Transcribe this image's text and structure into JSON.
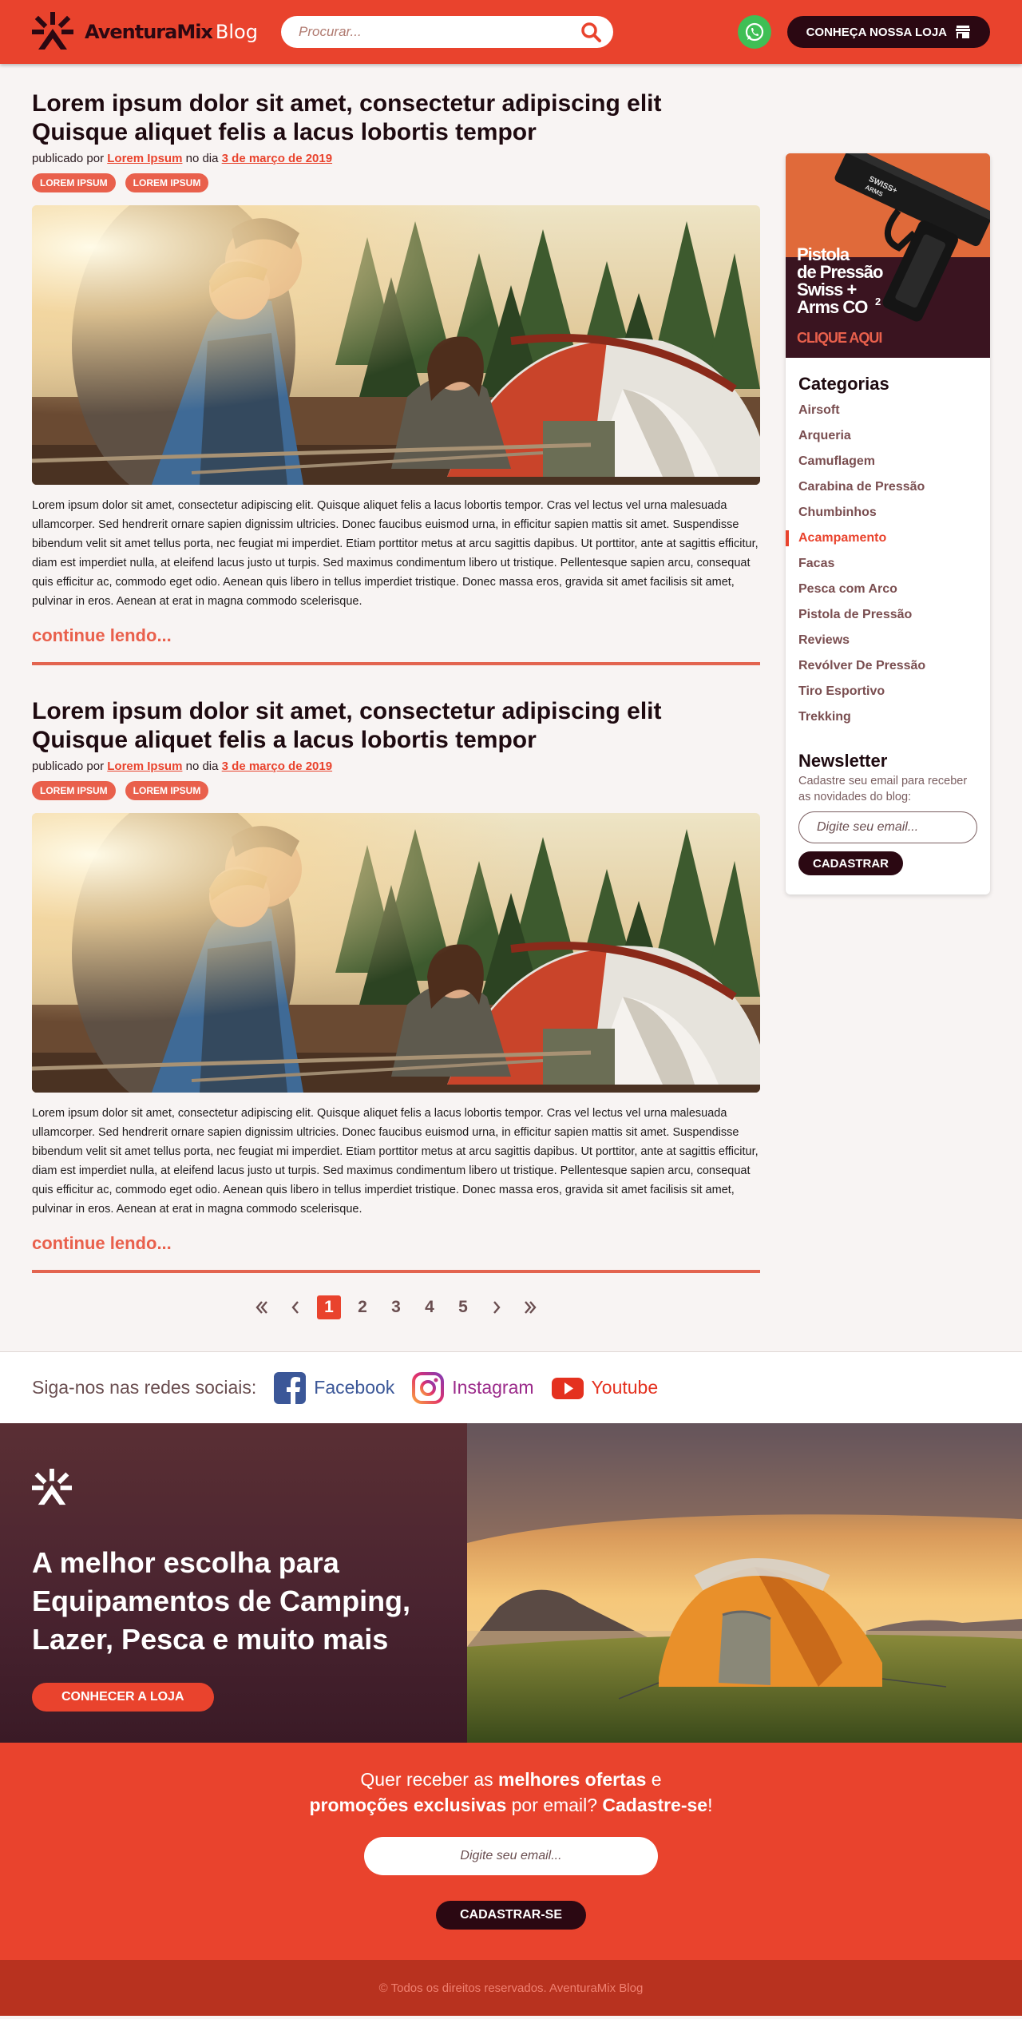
{
  "header": {
    "logo_text": "AventuraMix",
    "logo_suffix": "Blog",
    "search_placeholder": "Procurar...",
    "store_button": "CONHEÇA NOSSA LOJA",
    "icons": {
      "search": "search-icon",
      "whatsapp": "whatsapp-icon",
      "store": "store-icon"
    }
  },
  "posts": [
    {
      "title_line1": "Lorem ipsum dolor sit amet, consectetur adipiscing elit",
      "title_line2": "Quisque aliquet felis a lacus lobortis tempor",
      "meta_prefix": "publicado por",
      "author": "Lorem Ipsum",
      "meta_mid": "no dia",
      "date": "3 de março de 2019",
      "tags": [
        "LOREM IPSUM",
        "LOREM IPSUM"
      ],
      "body": "Lorem ipsum dolor sit amet, consectetur adipiscing elit. Quisque aliquet felis a lacus lobortis tempor. Cras vel lectus vel urna malesuada ullamcorper. Sed hendrerit ornare sapien dignissim ultricies. Donec faucibus euismod urna, in efficitur sapien mattis sit amet. Suspendisse bibendum velit sit amet tellus porta, nec feugiat mi imperdiet. Etiam porttitor metus at arcu sagittis dapibus. Ut porttitor, ante at sagittis efficitur, diam est imperdiet nulla, at eleifend lacus justo ut turpis. Sed maximus condimentum libero ut tristique. Pellentesque sapien arcu, consequat quis efficitur ac, commodo eget odio. Aenean quis libero in tellus imperdiet tristique. Donec massa eros, gravida sit amet facilisis sit amet, pulvinar in eros. Aenean at erat in magna commodo scelerisque.",
      "read_more": "continue lendo..."
    },
    {
      "title_line1": "Lorem ipsum dolor sit amet, consectetur adipiscing elit",
      "title_line2": "Quisque aliquet felis a lacus lobortis tempor",
      "meta_prefix": "publicado por",
      "author": "Lorem Ipsum",
      "meta_mid": "no dia",
      "date": "3 de março de 2019",
      "tags": [
        "LOREM IPSUM",
        "LOREM IPSUM"
      ],
      "body": "Lorem ipsum dolor sit amet, consectetur adipiscing elit. Quisque aliquet felis a lacus lobortis tempor. Cras vel lectus vel urna malesuada ullamcorper. Sed hendrerit ornare sapien dignissim ultricies. Donec faucibus euismod urna, in efficitur sapien mattis sit amet. Suspendisse bibendum velit sit amet tellus porta, nec feugiat mi imperdiet. Etiam porttitor metus at arcu sagittis dapibus. Ut porttitor, ante at sagittis efficitur, diam est imperdiet nulla, at eleifend lacus justo ut turpis. Sed maximus condimentum libero ut tristique. Pellentesque sapien arcu, consequat quis efficitur ac, commodo eget odio. Aenean quis libero in tellus imperdiet tristique. Donec massa eros, gravida sit amet facilisis sit amet, pulvinar in eros. Aenean at erat in magna commodo scelerisque.",
      "read_more": "continue lendo..."
    }
  ],
  "pagination": {
    "pages": [
      "1",
      "2",
      "3",
      "4",
      "5"
    ],
    "active": "1"
  },
  "sidebar": {
    "banner": {
      "line1": "Pistola",
      "line2": "de Pressão",
      "line3": "Swiss +",
      "line4": "Arms CO",
      "sup": "2",
      "cta": "CLIQUE AQUI",
      "gun_brand_1": "SWISS+",
      "gun_brand_2": "ARMS"
    },
    "categories_title": "Categorias",
    "categories": [
      "Airsoft",
      "Arqueria",
      "Camuflagem",
      "Carabina de Pressão",
      "Chumbinhos",
      "Acampamento",
      "Facas",
      "Pesca com Arco",
      "Pistola de Pressão",
      "Reviews",
      "Revólver De Pressão",
      "Tiro Esportivo",
      "Trekking"
    ],
    "active_category": "Acampamento",
    "newsletter_title": "Newsletter",
    "newsletter_desc": "Cadastre seu email para receber as novidades do blog:",
    "newsletter_placeholder": "Digite seu email...",
    "newsletter_button": "CADASTRAR"
  },
  "social": {
    "label": "Siga-nos nas redes sociais:",
    "facebook": "Facebook",
    "instagram": "Instagram",
    "youtube": "Youtube"
  },
  "hero": {
    "line1": "A melhor escolha para",
    "line2": "Equipamentos de Camping,",
    "line3": "Lazer, Pesca e muito mais",
    "button": "CONHECER A LOJA"
  },
  "cta": {
    "t1": "Quer receber as ",
    "t2": "melhores ofertas",
    "t3": " e",
    "t4": "promoções exclusivas",
    "t5": " por email? ",
    "t6": "Cadastre-se",
    "t7": "!",
    "placeholder": "Digite seu email...",
    "button": "CADASTRAR-SE"
  },
  "footer": {
    "copyright": "© Todos os direitos reservados. AventuraMix Blog"
  },
  "colors": {
    "brand": "#e9432d",
    "dark": "#2b0812",
    "footer": "#b8321f",
    "whatsapp": "#3fbf55"
  }
}
